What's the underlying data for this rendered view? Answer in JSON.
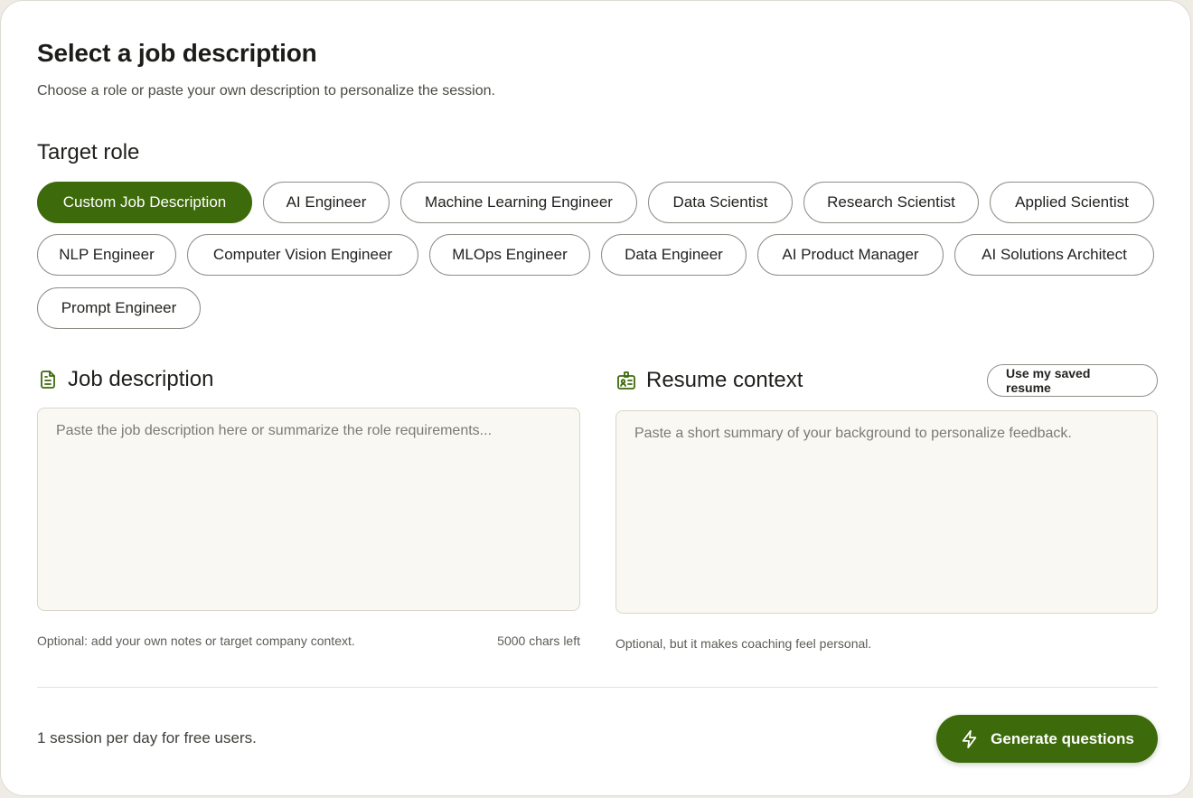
{
  "header": {
    "title": "Select a job description",
    "subtitle": "Choose a role or paste your own description to personalize the session."
  },
  "target_role": {
    "label": "Target role",
    "selected": "Custom Job Description",
    "roles": [
      "Custom Job Description",
      "AI Engineer",
      "Machine Learning Engineer",
      "Data Scientist",
      "Research Scientist",
      "Applied Scientist",
      "NLP Engineer",
      "Computer Vision Engineer",
      "MLOps Engineer",
      "Data Engineer",
      "AI Product Manager",
      "AI Solutions Architect",
      "Prompt Engineer"
    ]
  },
  "job_description": {
    "icon": "document-icon",
    "title": "Job description",
    "placeholder": "Paste the job description here or summarize the role requirements...",
    "value": "",
    "hint": "Optional: add your own notes or target company context.",
    "counter": "5000 chars left"
  },
  "resume_context": {
    "icon": "id-badge-icon",
    "title": "Resume context",
    "saved_resume_button": "Use my saved resume",
    "placeholder": "Paste a short summary of your background to personalize feedback.",
    "value": "",
    "hint": "Optional, but it makes coaching feel personal."
  },
  "footer": {
    "note": "1 session per day for free users.",
    "generate_button": "Generate questions",
    "generate_icon": "lightning-icon"
  },
  "colors": {
    "accent": "#3d6a0a",
    "chip_border": "#8f8d86",
    "textarea_bg": "#faf8f2"
  }
}
